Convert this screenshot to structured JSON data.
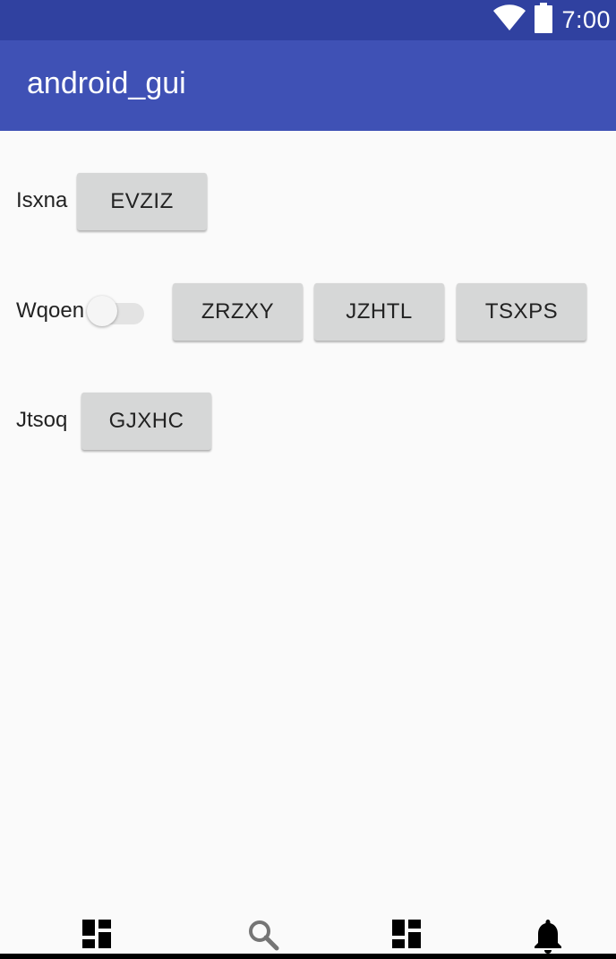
{
  "status_bar": {
    "time": "7:00",
    "icons": [
      "wifi-icon",
      "battery-icon"
    ]
  },
  "app_bar": {
    "title": "android_gui"
  },
  "rows": [
    {
      "label": "Isxna",
      "buttons": [
        "EVZIZ"
      ]
    },
    {
      "label": "Wqoen",
      "switch_on": false,
      "buttons": [
        "ZRZXY",
        "JZHTL",
        "TSXPS"
      ]
    },
    {
      "label": "Jtsoq",
      "buttons": [
        "GJXHC"
      ]
    }
  ],
  "bottom_nav": {
    "items": [
      "dashboard-icon",
      "search-icon",
      "dashboard-icon",
      "notifications-icon"
    ],
    "colors": {
      "active": "#000000",
      "inactive": "#757575"
    }
  },
  "colors": {
    "status_bar": "#3041a0",
    "app_bar": "#3f51b5",
    "background": "#fafafa",
    "button": "#d6d7d7"
  }
}
